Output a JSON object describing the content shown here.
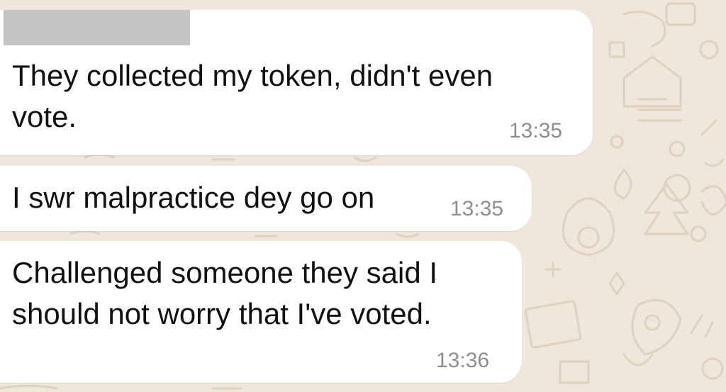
{
  "chat": {
    "messages": [
      {
        "text": "They collected my token, didn't even\nvote.",
        "time": "13:35",
        "sender_redacted": true
      },
      {
        "text": "I swr malpractice dey go on",
        "time": "13:35"
      },
      {
        "text": "Challenged someone they said I\nshould not worry that I've voted.",
        "time": "13:36"
      }
    ]
  },
  "colors": {
    "wallpaper": "#efe7dc",
    "bubble": "#ffffff",
    "text": "#111111",
    "timestamp": "#8e8e8e",
    "redaction": "#c5c5c5"
  }
}
